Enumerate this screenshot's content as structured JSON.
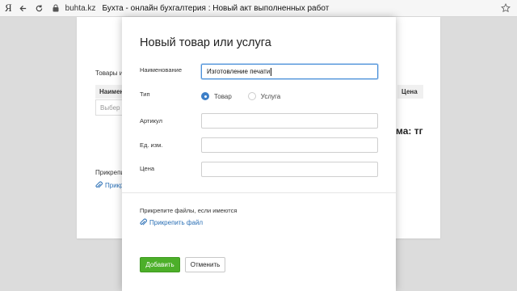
{
  "browser": {
    "yandex_glyph": "Я",
    "host": "buhta.kz",
    "title": "Бухта - онлайн бухгалтерия : Новый акт выполненных работ"
  },
  "background_page": {
    "goods_label": "Товары и",
    "name_header": "Наимено",
    "price_header": "Цена",
    "select_placeholder": "Выбер",
    "total_fragment": "ма: тг",
    "attach_label": "Прикрепи",
    "attach_link": "Прикр"
  },
  "modal": {
    "title": "Новый товар или услуга",
    "fields": {
      "name_label": "Наименование",
      "name_value": "Изготовление печати",
      "type_label": "Тип",
      "type_goods": "Товар",
      "type_service": "Услуга",
      "article_label": "Артикул",
      "article_value": "",
      "unit_label": "Ед. изм.",
      "unit_value": "",
      "price_label": "Цена",
      "price_value": ""
    },
    "attach_text": "Прикрепите файлы, если имеются",
    "attach_link": "Прикрепить файл",
    "add_button": "Добавить",
    "cancel_button": "Отменить"
  },
  "colors": {
    "primary_button": "#4caf29",
    "link": "#2a6fb5",
    "radio_checked": "#3d7fc8",
    "focus_border": "#4a90d9"
  },
  "icons": {
    "back": "back-arrow-icon",
    "reload": "reload-icon",
    "lock": "lock-icon",
    "bookmark": "bookmark-star-icon",
    "attach": "paperclip-icon"
  }
}
